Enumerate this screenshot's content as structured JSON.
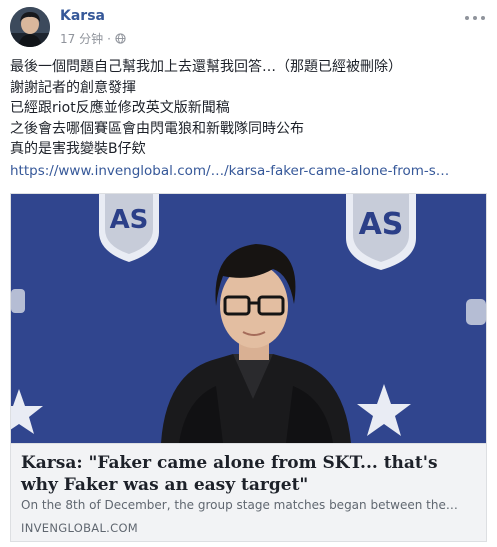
{
  "post": {
    "author": "Karsa",
    "time": "17 分钟",
    "lines": [
      "最後一個問題自己幫我加上去還幫我回答…（那題已經被刪除）",
      "謝謝記者的創意發揮",
      "已經跟riot反應並修改英文版新聞稿",
      "之後會去哪個賽區會由閃電狼和新戰隊同時公布",
      "真的是害我變裝B仔欸"
    ],
    "link": "https://www.invenglobal.com/…/karsa-faker-came-alone-from-s…"
  },
  "card": {
    "title": "Karsa: \"Faker came alone from SKT... that's why Faker was an easy target\"",
    "description": "On the 8th of December, the group stage matches began between the…",
    "domain": "INVENGLOBAL.COM",
    "image_badge_text": "AS"
  },
  "icons": {
    "privacy": "globe-icon",
    "options": "more-options-icon"
  },
  "colors": {
    "link": "#365899",
    "meta": "#90949c",
    "card_background": "#f2f3f5",
    "photo_backdrop": "#2b3f88"
  }
}
